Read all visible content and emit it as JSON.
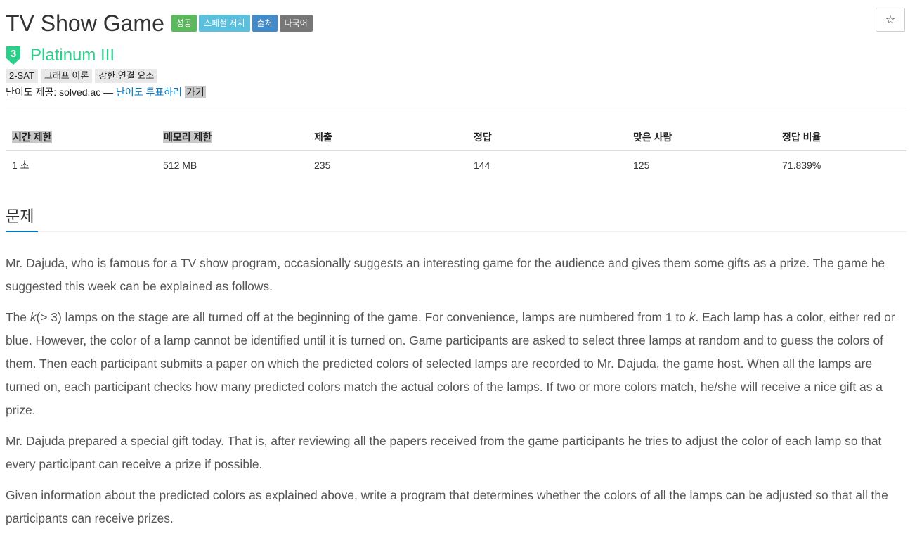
{
  "header": {
    "title": "TV Show Game",
    "badges": [
      {
        "label": "성공",
        "color": "#5cb85c"
      },
      {
        "label": "스페셜 저지",
        "color": "#5bc0de"
      },
      {
        "label": "출처",
        "color": "#428bca"
      },
      {
        "label": "다국어",
        "color": "#777777"
      }
    ],
    "star_icon": "☆"
  },
  "tier": {
    "number": "3",
    "label": "Platinum III",
    "color": "#2ad08a"
  },
  "tags": [
    "2-SAT",
    "그래프 이론",
    "강한 연결 요소"
  ],
  "provider": {
    "prefix": "난이도 제공: solved.ac — ",
    "vote_link": "난이도 투표하러",
    "go": "가기"
  },
  "info_table": {
    "headers": [
      "시간 제한",
      "메모리 제한",
      "제출",
      "정답",
      "맞은 사람",
      "정답 비율"
    ],
    "values": [
      "1 초",
      "512 MB",
      "235",
      "144",
      "125",
      "71.839%"
    ]
  },
  "section": {
    "title": "문제"
  },
  "problem": {
    "p1": "Mr. Dajuda, who is famous for a TV show program, occasionally suggests an interesting game for the audience and gives them some gifts as a prize. The game he suggested this week can be explained as follows.",
    "p2_pre": "The ",
    "p2_var": "k",
    "p2_mid": "(> 3) lamps on the stage are all turned off at the beginning of the game. For convenience, lamps are numbered from 1 to ",
    "p2_var2": "k",
    "p2_post": ". Each lamp has a color, either red or blue. However, the color of a lamp cannot be identified until it is turned on. Game participants are asked to select three lamps at random and to guess the colors of them. Then each participant submits a paper on which the predicted colors of selected lamps are recorded to Mr. Dajuda, the game host. When all the lamps are turned on, each participant checks how many predicted colors match the actual colors of the lamps. If two or more colors match, he/she will receive a nice gift as a prize.",
    "p3": "Mr. Dajuda prepared a special gift today. That is, after reviewing all the papers received from the game participants he tries to adjust the color of each lamp so that every participant can receive a prize if possible.",
    "p4": "Given information about the predicted colors as explained above, write a program that determines whether the colors of all the lamps can be adjusted so that all the participants can receive prizes."
  }
}
